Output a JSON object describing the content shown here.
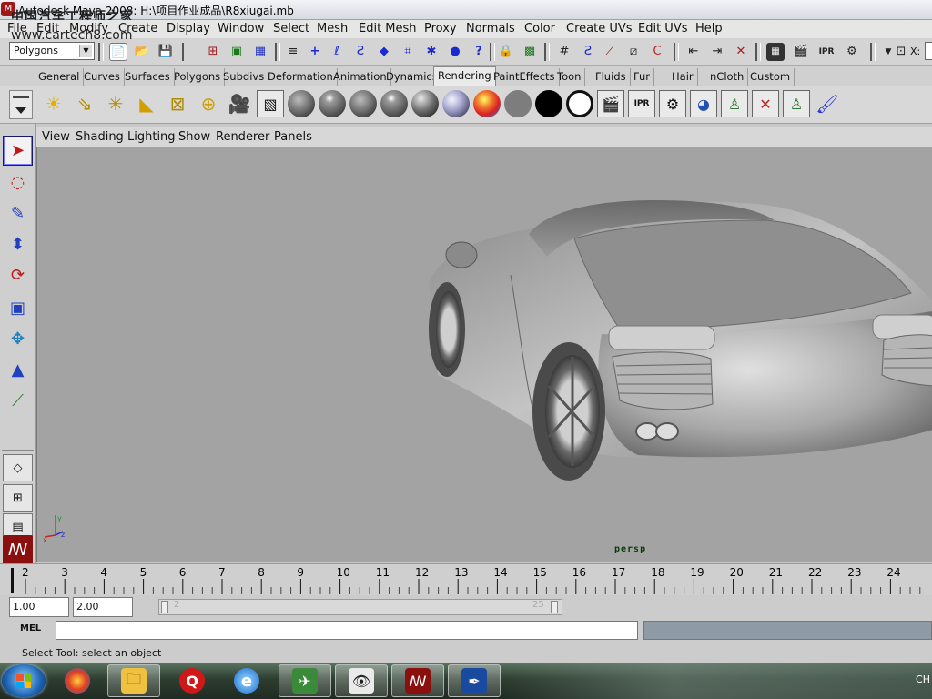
{
  "window": {
    "title": "Autodesk Maya 2008: H:\\项目作业成品\\R8xiugai.mb",
    "watermark_cn": "中国汽车工程师之家",
    "watermark_url": "www.cartech8.com"
  },
  "menu": [
    "File",
    "Edit",
    "Modify",
    "Create",
    "Display",
    "Window",
    "Select",
    "Mesh",
    "Edit Mesh",
    "Proxy",
    "Normals",
    "Color",
    "Create UVs",
    "Edit UVs",
    "Help"
  ],
  "status_line": {
    "mode": "Polygons",
    "x_label": "X:"
  },
  "shelf_tabs": [
    "General",
    "Curves",
    "Surfaces",
    "Polygons",
    "Subdivs",
    "Deformation",
    "Animation",
    "Dynamics",
    "Rendering",
    "PaintEffects",
    "Toon",
    "Fluids",
    "Fur",
    "Hair",
    "nCloth",
    "Custom"
  ],
  "active_shelf_tab": "Rendering",
  "panel_menu": [
    "View",
    "Shading",
    "Lighting",
    "Show",
    "Renderer",
    "Panels"
  ],
  "viewport": {
    "camera": "persp"
  },
  "time_slider": {
    "ticks": [
      "2",
      "3",
      "4",
      "5",
      "6",
      "7",
      "8",
      "9",
      "10",
      "11",
      "12",
      "13",
      "14",
      "15",
      "16",
      "17",
      "18",
      "19",
      "20",
      "21",
      "22",
      "23",
      "24"
    ]
  },
  "range_slider": {
    "start": "1.00",
    "playback_start": "2.00",
    "track_start_label": "2",
    "track_end_label": "25"
  },
  "command_line": {
    "label": "MEL"
  },
  "help_line": {
    "text": "Select Tool: select an object"
  },
  "taskbar": {
    "lang": "CH"
  }
}
